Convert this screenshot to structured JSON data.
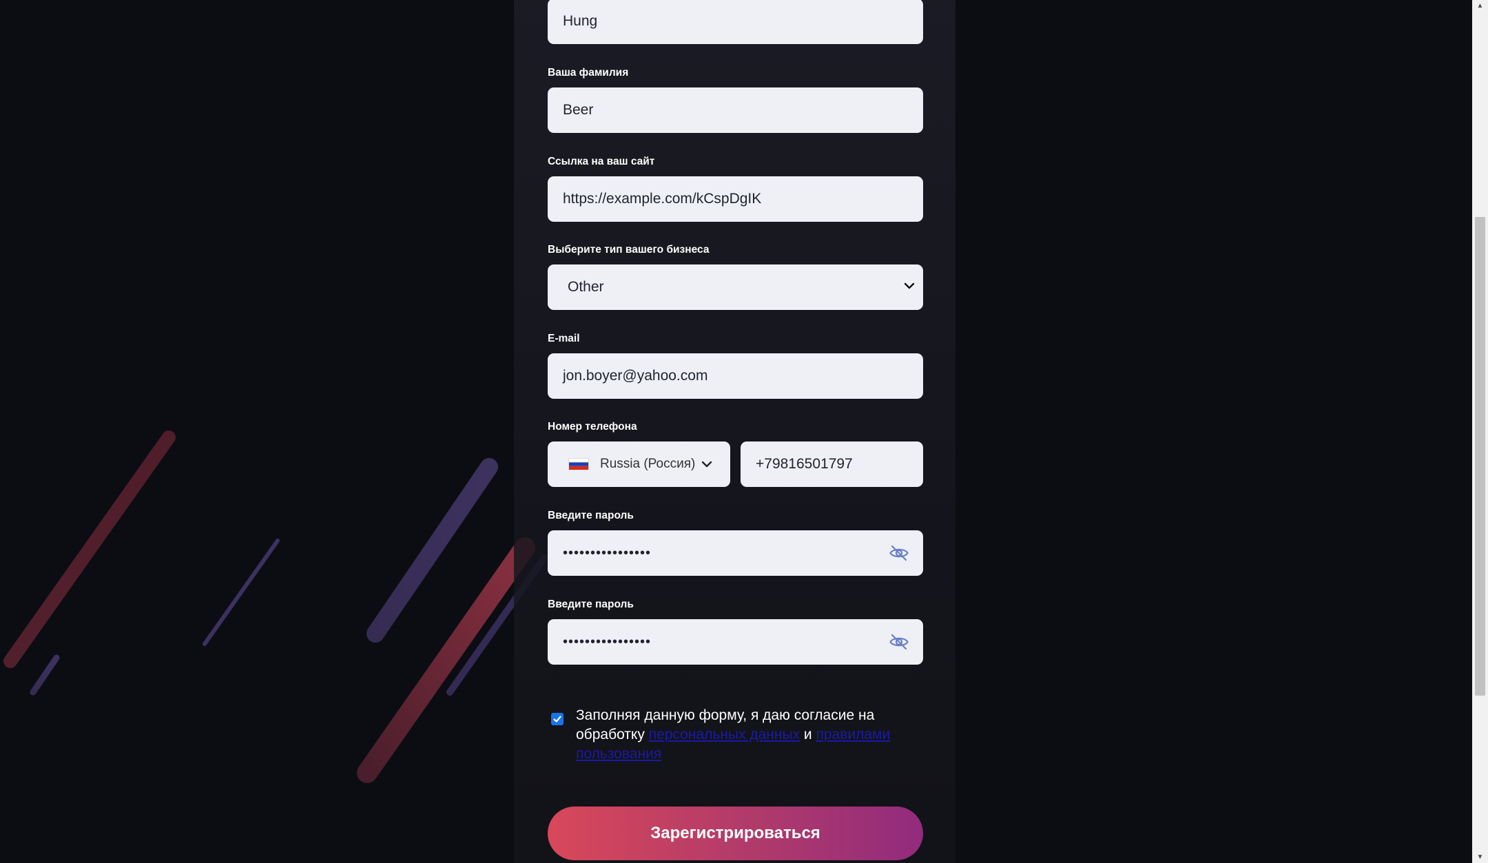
{
  "form": {
    "first_name_value": "Hung",
    "last_name_label": "Ваша фамилия",
    "last_name_value": "Beer",
    "website_label": "Ссылка на ваш сайт",
    "website_value": "https://example.com/kCspDgIK",
    "business_type_label": "Выберите тип вашего бизнеса",
    "business_type_value": "Other",
    "email_label": "E-mail",
    "email_value": "jon.boyer@yahoo.com",
    "phone_label": "Номер телефона",
    "phone_country": "Russia (Россия)",
    "phone_value": "+79816501797",
    "password_label": "Введите пароль",
    "password_value": "••••••••••••••••",
    "password_confirm_label": "Введите пароль",
    "password_confirm_value": "••••••••••••••••",
    "consent_text_1": "Заполняя данную форму, я даю согласие на обработку",
    "consent_link_1": "персональных данных",
    "consent_and": "и",
    "consent_link_2": "правилами пользования",
    "consent_checked": true,
    "submit_label": "Зарегистрироваться"
  },
  "icons": {
    "flag": "russia-flag-icon",
    "dropdown": "chevron-down-icon",
    "password_toggle": "eye-off-icon",
    "checkbox": "checkmark-icon"
  },
  "colors": {
    "page_background": "#0b0d12",
    "input_background": "#eef0f6",
    "button_gradient_start": "#d8485a",
    "button_gradient_end": "#922b7e",
    "link": "#1a1aa6",
    "checkbox": "#1a73e8"
  }
}
